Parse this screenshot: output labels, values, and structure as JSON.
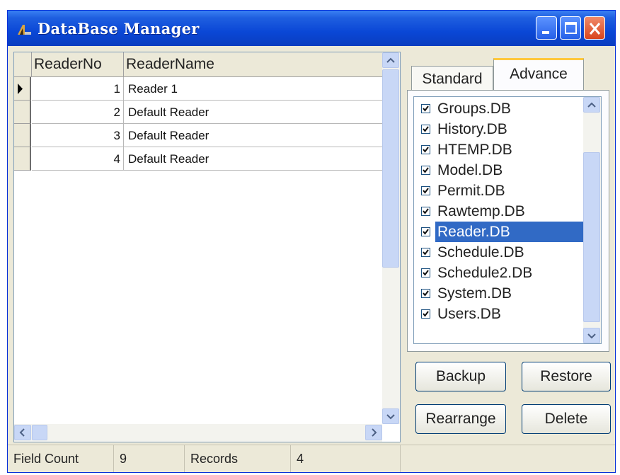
{
  "window": {
    "title": "DataBase Manager",
    "buttons": [
      "minimize",
      "maximize",
      "close"
    ],
    "accent_color": "#0a47d6"
  },
  "grid": {
    "columns": [
      "ReaderNo",
      "ReaderName"
    ],
    "rows": [
      {
        "no": "1",
        "name": "Reader 1"
      },
      {
        "no": "2",
        "name": "Default Reader"
      },
      {
        "no": "3",
        "name": "Default Reader"
      },
      {
        "no": "4",
        "name": "Default Reader"
      }
    ],
    "current_row_index": 0
  },
  "tabs": {
    "items": [
      {
        "label": "Standard",
        "active": false
      },
      {
        "label": "Advance",
        "active": true
      }
    ]
  },
  "db_list": {
    "items": [
      {
        "label": "Groups.DB",
        "checked": true
      },
      {
        "label": "History.DB",
        "checked": true
      },
      {
        "label": "HTEMP.DB",
        "checked": true
      },
      {
        "label": "Model.DB",
        "checked": true
      },
      {
        "label": "Permit.DB",
        "checked": true
      },
      {
        "label": "Rawtemp.DB",
        "checked": true
      },
      {
        "label": "Reader.DB",
        "checked": true,
        "selected": true
      },
      {
        "label": "Schedule.DB",
        "checked": true
      },
      {
        "label": "Schedule2.DB",
        "checked": true
      },
      {
        "label": "System.DB",
        "checked": true
      },
      {
        "label": "Users.DB",
        "checked": true
      }
    ],
    "selection_color": "#316ac5"
  },
  "actions": {
    "backup": "Backup",
    "restore": "Restore",
    "rearrange": "Rearrange",
    "delete": "Delete"
  },
  "status": {
    "field_count_label": "Field Count",
    "field_count": "9",
    "records_label": "Records",
    "records": "4"
  }
}
